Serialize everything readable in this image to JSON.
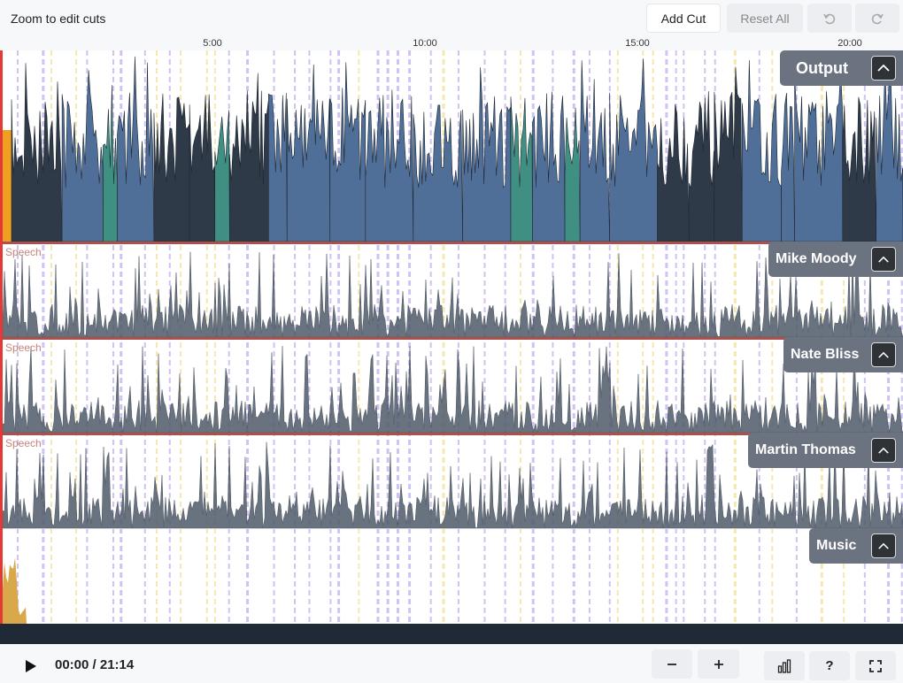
{
  "toolbar": {
    "hint": "Zoom to edit cuts",
    "add_cut_label": "Add Cut",
    "reset_all_label": "Reset All",
    "undo_icon": "undo-icon",
    "redo_icon": "redo-icon"
  },
  "timeline": {
    "ticks": [
      "5:00",
      "10:00",
      "15:00",
      "20:00"
    ]
  },
  "tracks": [
    {
      "name": "Output",
      "type": "output"
    },
    {
      "name": "Mike Moody",
      "type": "speech",
      "tag": "Speech"
    },
    {
      "name": "Nate Bliss",
      "type": "speech",
      "tag": "Speech"
    },
    {
      "name": "Martin Thomas",
      "type": "speech",
      "tag": "Speech"
    },
    {
      "name": "Music",
      "type": "music"
    }
  ],
  "player": {
    "time": "00:00 / 21:14",
    "play_icon": "play-icon",
    "zoom_out_icon": "minus-icon",
    "zoom_in_icon": "plus-icon",
    "stats_icon": "bar-chart-icon",
    "help_label": "?",
    "fullscreen_icon": "fullscreen-icon"
  },
  "colors": {
    "playhead": "#e53935",
    "output_blue": "#4f6f98",
    "output_teal": "#3f9083",
    "output_dark": "#2f3a48",
    "output_orange": "#f0a020",
    "speech_wave": "#4f5b6b",
    "music_wave": "#d8a84a",
    "cut_purple": "#c9bdf2",
    "cut_yellow": "#f4e6a6",
    "track_divider": "#a9514a"
  }
}
